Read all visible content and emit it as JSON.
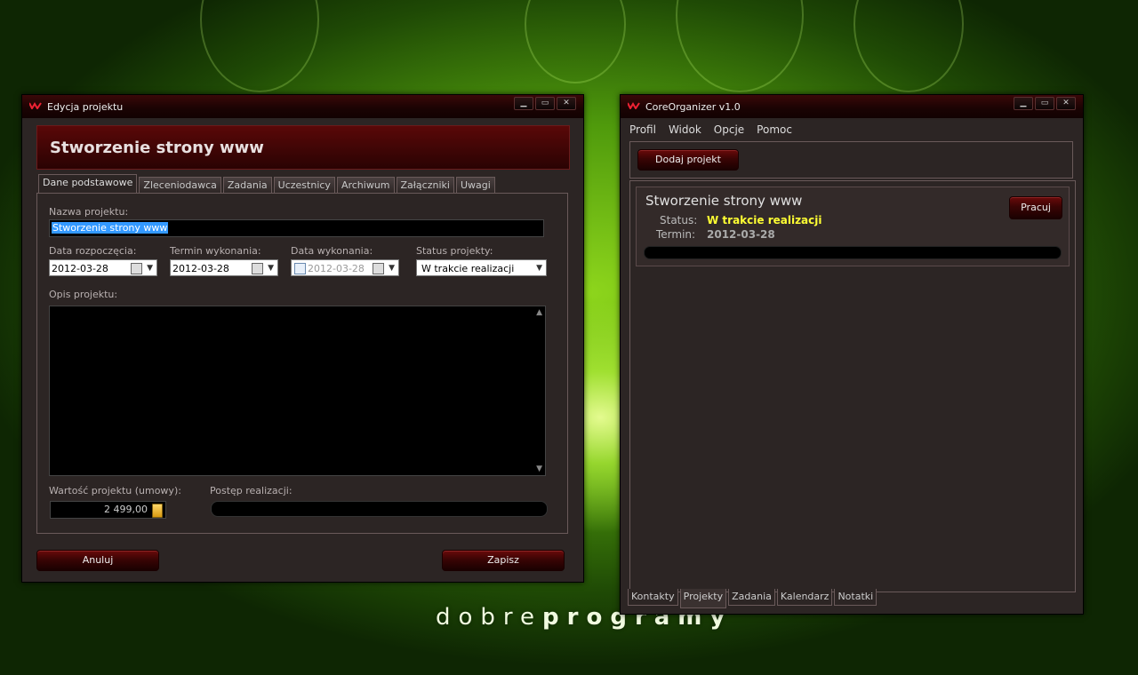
{
  "background": {
    "brand_light": "dobre",
    "brand_bold": "programy"
  },
  "edit_window": {
    "title": "Edycja projektu",
    "header": "Stworzenie strony www",
    "tabs": [
      "Dane podstawowe",
      "Zleceniodawca",
      "Zadania",
      "Uczestnicy",
      "Archiwum",
      "Załączniki",
      "Uwagi"
    ],
    "active_tab": "Dane podstawowe",
    "fields": {
      "name_label": "Nazwa projektu:",
      "name_value": "Stworzenie strony www",
      "start_label": "Data rozpoczęcia:",
      "start_value": "2012-03-28",
      "deadline_label": "Termin wykonania:",
      "deadline_value": "2012-03-28",
      "done_label": "Data wykonania:",
      "done_value": "2012-03-28",
      "status_label": "Status projekty:",
      "status_value": "W trakcie realizacji",
      "desc_label": "Opis projektu:",
      "value_label": "Wartość projektu (umowy):",
      "value_value": "2 499,00",
      "progress_label": "Postęp realizacji:",
      "progress_fraction": 0
    },
    "buttons": {
      "cancel": "Anuluj",
      "save": "Zapisz"
    }
  },
  "main_window": {
    "title": "CoreOrganizer v1.0",
    "menu": [
      "Profil",
      "Widok",
      "Opcje",
      "Pomoc"
    ],
    "add_button": "Dodaj projekt",
    "project": {
      "name": "Stworzenie strony www",
      "status_label": "Status:",
      "status_value": "W trakcie realizacji",
      "deadline_label": "Termin:",
      "deadline_value": "2012-03-28",
      "work_button": "Pracuj",
      "progress_fraction": 0
    },
    "bottom_tabs": [
      "Kontakty",
      "Projekty",
      "Zadania",
      "Kalendarz",
      "Notatki"
    ],
    "active_bottom_tab": "Projekty"
  },
  "colors": {
    "accent_red": "#5a0808",
    "status_yellow": "#ffff33",
    "bg_green": "#4f9a0c"
  },
  "icons": [
    "app-logo-icon",
    "minimize-icon",
    "maximize-icon",
    "close-icon",
    "calendar-icon",
    "dropdown-arrow-icon",
    "calculator-icon",
    "scroll-up-icon",
    "scroll-down-icon"
  ]
}
